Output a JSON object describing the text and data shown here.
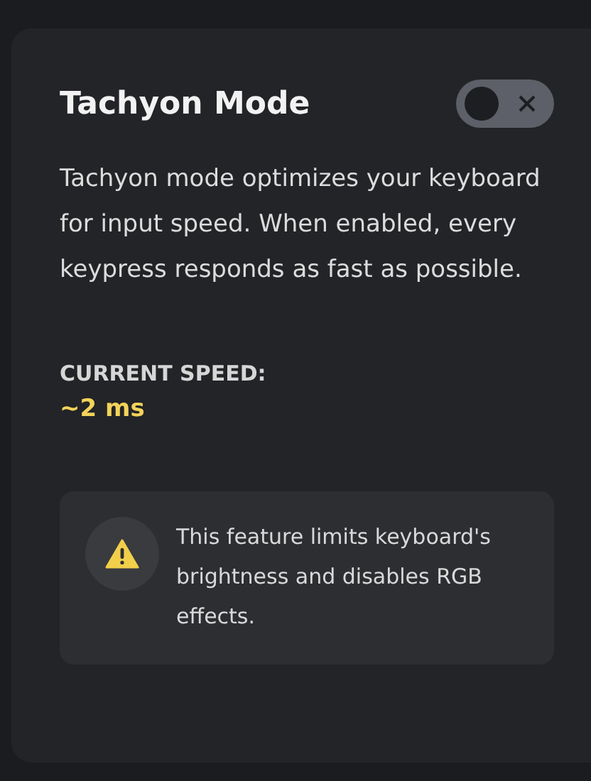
{
  "title": "Tachyon Mode",
  "toggle": {
    "on": false
  },
  "description": "Tachyon mode optimizes your keyboard for input speed. When enabled, every keypress responds as fast as possible.",
  "speed": {
    "label": "CURRENT SPEED:",
    "value": "~2 ms"
  },
  "warning": {
    "text": "This feature limits keyboard's brightness and disables RGB effects."
  }
}
